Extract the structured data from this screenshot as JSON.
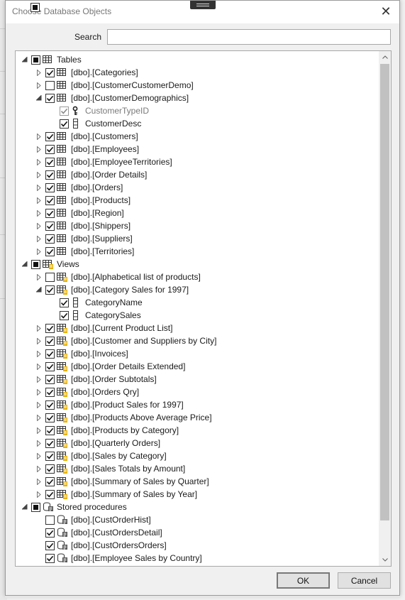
{
  "dialog": {
    "title": "Choose Database Objects",
    "close_glyph": "✕",
    "search_label": "Search",
    "search_value": "",
    "ok_label": "OK",
    "cancel_label": "Cancel"
  },
  "tree": [
    {
      "level": 0,
      "expander": "expanded",
      "check": "partial",
      "icon": "table-icon",
      "label": "Tables"
    },
    {
      "level": 1,
      "expander": "collapsed",
      "check": "checked",
      "icon": "table-icon",
      "label": "[dbo].[Categories]"
    },
    {
      "level": 1,
      "expander": "collapsed",
      "check": "unchecked",
      "icon": "table-icon",
      "label": "[dbo].[CustomerCustomerDemo]"
    },
    {
      "level": 1,
      "expander": "expanded",
      "check": "checked",
      "icon": "table-icon",
      "label": "[dbo].[CustomerDemographics]"
    },
    {
      "level": 2,
      "expander": "none",
      "check": "checked-disabled",
      "icon": "key-icon",
      "label": "CustomerTypeID",
      "grey": true
    },
    {
      "level": 2,
      "expander": "none",
      "check": "checked",
      "icon": "column-icon",
      "label": "CustomerDesc"
    },
    {
      "level": 1,
      "expander": "collapsed",
      "check": "checked",
      "icon": "table-icon",
      "label": "[dbo].[Customers]"
    },
    {
      "level": 1,
      "expander": "collapsed",
      "check": "checked",
      "icon": "table-icon",
      "label": "[dbo].[Employees]"
    },
    {
      "level": 1,
      "expander": "collapsed",
      "check": "checked",
      "icon": "table-icon",
      "label": "[dbo].[EmployeeTerritories]"
    },
    {
      "level": 1,
      "expander": "collapsed",
      "check": "checked",
      "icon": "table-icon",
      "label": "[dbo].[Order Details]"
    },
    {
      "level": 1,
      "expander": "collapsed",
      "check": "checked",
      "icon": "table-icon",
      "label": "[dbo].[Orders]"
    },
    {
      "level": 1,
      "expander": "collapsed",
      "check": "checked",
      "icon": "table-icon",
      "label": "[dbo].[Products]"
    },
    {
      "level": 1,
      "expander": "collapsed",
      "check": "checked",
      "icon": "table-icon",
      "label": "[dbo].[Region]"
    },
    {
      "level": 1,
      "expander": "collapsed",
      "check": "checked",
      "icon": "table-icon",
      "label": "[dbo].[Shippers]"
    },
    {
      "level": 1,
      "expander": "collapsed",
      "check": "checked",
      "icon": "table-icon",
      "label": "[dbo].[Suppliers]"
    },
    {
      "level": 1,
      "expander": "collapsed",
      "check": "checked",
      "icon": "table-icon",
      "label": "[dbo].[Territories]"
    },
    {
      "level": 0,
      "expander": "expanded",
      "check": "partial",
      "icon": "view-icon",
      "label": "Views"
    },
    {
      "level": 1,
      "expander": "collapsed",
      "check": "unchecked",
      "icon": "view-icon",
      "label": "[dbo].[Alphabetical list of products]"
    },
    {
      "level": 1,
      "expander": "expanded",
      "check": "checked",
      "icon": "view-icon",
      "label": "[dbo].[Category Sales for 1997]"
    },
    {
      "level": 2,
      "expander": "none",
      "check": "checked",
      "icon": "column-icon",
      "label": "CategoryName"
    },
    {
      "level": 2,
      "expander": "none",
      "check": "checked",
      "icon": "column-icon",
      "label": "CategorySales"
    },
    {
      "level": 1,
      "expander": "collapsed",
      "check": "checked",
      "icon": "view-icon",
      "label": "[dbo].[Current Product List]"
    },
    {
      "level": 1,
      "expander": "collapsed",
      "check": "checked",
      "icon": "view-icon",
      "label": "[dbo].[Customer and Suppliers by City]"
    },
    {
      "level": 1,
      "expander": "collapsed",
      "check": "checked",
      "icon": "view-icon",
      "label": "[dbo].[Invoices]"
    },
    {
      "level": 1,
      "expander": "collapsed",
      "check": "checked",
      "icon": "view-icon",
      "label": "[dbo].[Order Details Extended]"
    },
    {
      "level": 1,
      "expander": "collapsed",
      "check": "checked",
      "icon": "view-icon",
      "label": "[dbo].[Order Subtotals]"
    },
    {
      "level": 1,
      "expander": "collapsed",
      "check": "checked",
      "icon": "view-icon",
      "label": "[dbo].[Orders Qry]"
    },
    {
      "level": 1,
      "expander": "collapsed",
      "check": "checked",
      "icon": "view-icon",
      "label": "[dbo].[Product Sales for 1997]"
    },
    {
      "level": 1,
      "expander": "collapsed",
      "check": "checked",
      "icon": "view-icon",
      "label": "[dbo].[Products Above Average Price]"
    },
    {
      "level": 1,
      "expander": "collapsed",
      "check": "checked",
      "icon": "view-icon",
      "label": "[dbo].[Products by Category]"
    },
    {
      "level": 1,
      "expander": "collapsed",
      "check": "checked",
      "icon": "view-icon",
      "label": "[dbo].[Quarterly Orders]"
    },
    {
      "level": 1,
      "expander": "collapsed",
      "check": "checked",
      "icon": "view-icon",
      "label": "[dbo].[Sales by Category]"
    },
    {
      "level": 1,
      "expander": "collapsed",
      "check": "checked",
      "icon": "view-icon",
      "label": "[dbo].[Sales Totals by Amount]"
    },
    {
      "level": 1,
      "expander": "collapsed",
      "check": "checked",
      "icon": "view-icon",
      "label": "[dbo].[Summary of Sales by Quarter]"
    },
    {
      "level": 1,
      "expander": "collapsed",
      "check": "checked",
      "icon": "view-icon",
      "label": "[dbo].[Summary of Sales by Year]"
    },
    {
      "level": 0,
      "expander": "expanded",
      "check": "partial",
      "icon": "procedure-icon",
      "label": "Stored procedures"
    },
    {
      "level": 1,
      "expander": "none",
      "check": "unchecked",
      "icon": "procedure-icon",
      "label": "[dbo].[CustOrderHist]"
    },
    {
      "level": 1,
      "expander": "none",
      "check": "checked",
      "icon": "procedure-icon",
      "label": "[dbo].[CustOrdersDetail]"
    },
    {
      "level": 1,
      "expander": "none",
      "check": "checked",
      "icon": "procedure-icon",
      "label": "[dbo].[CustOrdersOrders]"
    },
    {
      "level": 1,
      "expander": "none",
      "check": "checked",
      "icon": "procedure-icon",
      "label": "[dbo].[Employee Sales by Country]"
    }
  ],
  "colors": {
    "accent_badge": "#e8b000",
    "scroll_thumb": "#c1c1c1"
  }
}
